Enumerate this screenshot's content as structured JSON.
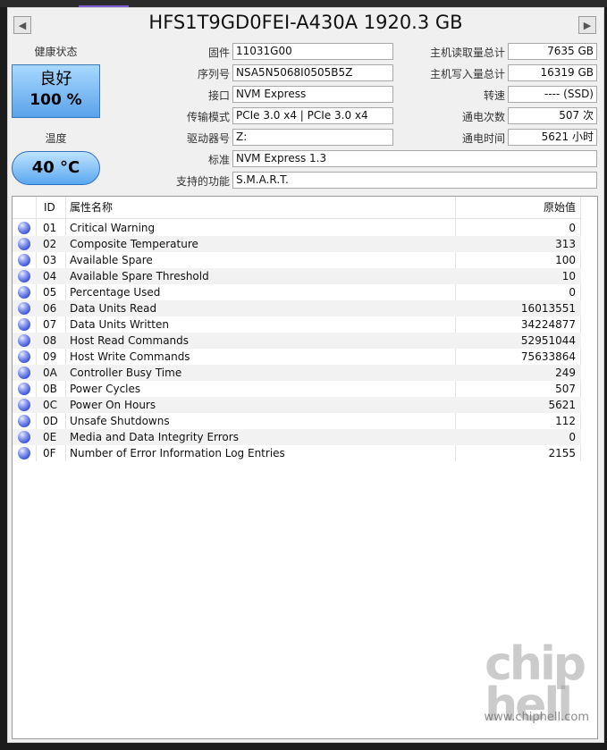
{
  "header": {
    "model": "HFS1T9GD0FEI-A430A 1920.3 GB",
    "prev_icon": "left-arrow-icon",
    "next_icon": "right-arrow-icon"
  },
  "status": {
    "health_label": "健康状态",
    "health_text": "良好",
    "health_percent": "100 %",
    "temp_label": "温度",
    "temp_value": "40 °C"
  },
  "info_left": [
    {
      "label": "固件",
      "value": "11031G00"
    },
    {
      "label": "序列号",
      "value": "NSA5N5068I0505B5Z"
    },
    {
      "label": "接口",
      "value": "NVM Express"
    },
    {
      "label": "传输模式",
      "value": "PCIe 3.0 x4 | PCIe 3.0 x4"
    },
    {
      "label": "驱动器号",
      "value": "Z:"
    }
  ],
  "info_right": [
    {
      "label": "主机读取量总计",
      "value": "7635 GB"
    },
    {
      "label": "主机写入量总计",
      "value": "16319 GB"
    },
    {
      "label": "转速",
      "value": "---- (SSD)"
    },
    {
      "label": "通电次数",
      "value": "507 次"
    },
    {
      "label": "通电时间",
      "value": "5621 小时"
    }
  ],
  "standard": {
    "label": "标准",
    "value": "NVM Express 1.3"
  },
  "features": {
    "label": "支持的功能",
    "value": "S.M.A.R.T."
  },
  "smart": {
    "columns": {
      "id": "ID",
      "name": "属性名称",
      "raw": "原始值"
    },
    "rows": [
      {
        "id": "01",
        "name": "Critical Warning",
        "raw": "0"
      },
      {
        "id": "02",
        "name": "Composite Temperature",
        "raw": "313"
      },
      {
        "id": "03",
        "name": "Available Spare",
        "raw": "100"
      },
      {
        "id": "04",
        "name": "Available Spare Threshold",
        "raw": "10"
      },
      {
        "id": "05",
        "name": "Percentage Used",
        "raw": "0"
      },
      {
        "id": "06",
        "name": "Data Units Read",
        "raw": "16013551"
      },
      {
        "id": "07",
        "name": "Data Units Written",
        "raw": "34224877"
      },
      {
        "id": "08",
        "name": "Host Read Commands",
        "raw": "52951044"
      },
      {
        "id": "09",
        "name": "Host Write Commands",
        "raw": "75633864"
      },
      {
        "id": "0A",
        "name": "Controller Busy Time",
        "raw": "249"
      },
      {
        "id": "0B",
        "name": "Power Cycles",
        "raw": "507"
      },
      {
        "id": "0C",
        "name": "Power On Hours",
        "raw": "5621"
      },
      {
        "id": "0D",
        "name": "Unsafe Shutdowns",
        "raw": "112"
      },
      {
        "id": "0E",
        "name": "Media and Data Integrity Errors",
        "raw": "0"
      },
      {
        "id": "0F",
        "name": "Number of Error Information Log Entries",
        "raw": "2155"
      }
    ]
  },
  "watermark": {
    "logo": "chip hell",
    "url": "www.chiphell.com"
  },
  "colors": {
    "tab_accent": "#7c5cd6",
    "health_bg": "#5aa2ea",
    "status_dot": "#3a52d0"
  }
}
